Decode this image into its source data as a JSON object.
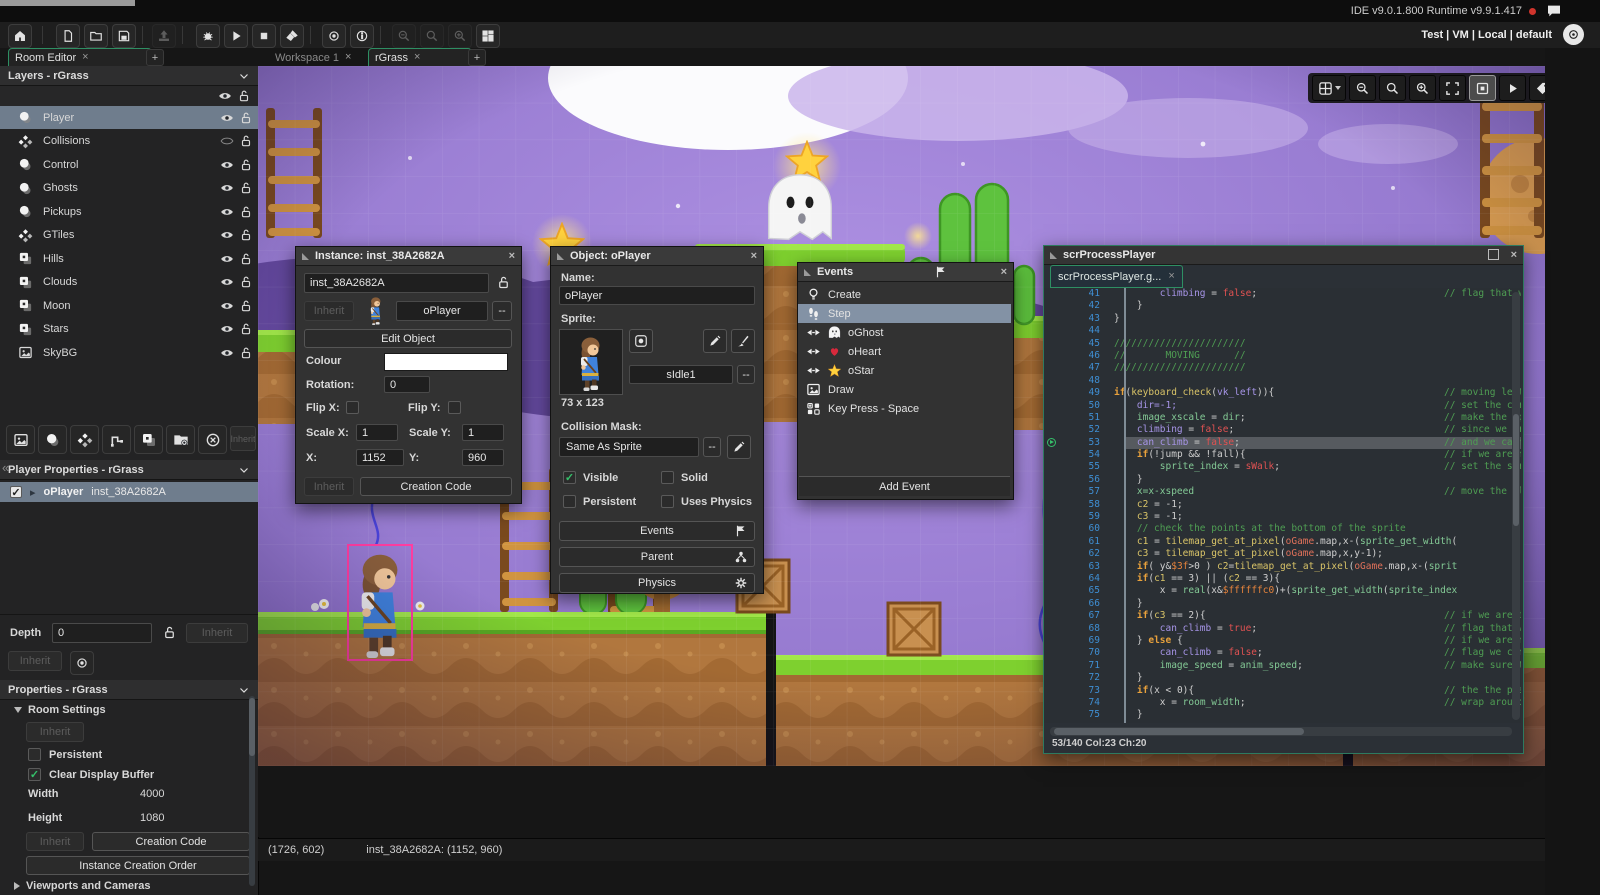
{
  "titlebar": {
    "version_text": "IDE v9.0.1.800 Runtime v9.9.1.417",
    "config_text": "Test | VM | Local | default"
  },
  "ui": {
    "more": "--",
    "inherit": "Inherit",
    "add": "+"
  },
  "tabs": {
    "left": [
      {
        "label": "Room Editor",
        "active": true
      }
    ],
    "right": [
      {
        "label": "Workspace 1",
        "active": false
      },
      {
        "label": "rGrass",
        "active": true
      }
    ]
  },
  "layers_panel": {
    "title": "Layers - rGrass",
    "items": [
      {
        "label": "Player",
        "icon": "instance",
        "visible": true,
        "selected": true
      },
      {
        "label": "Collisions",
        "icon": "tile",
        "visible": false,
        "selected": false
      },
      {
        "label": "Control",
        "icon": "instance",
        "visible": true,
        "selected": false
      },
      {
        "label": "Ghosts",
        "icon": "instance",
        "visible": true,
        "selected": false
      },
      {
        "label": "Pickups",
        "icon": "instance",
        "visible": true,
        "selected": false
      },
      {
        "label": "GTiles",
        "icon": "tile",
        "visible": true,
        "selected": false
      },
      {
        "label": "Hills",
        "icon": "asset",
        "visible": true,
        "selected": false
      },
      {
        "label": "Clouds",
        "icon": "asset",
        "visible": true,
        "selected": false
      },
      {
        "label": "Moon",
        "icon": "asset",
        "visible": true,
        "selected": false
      },
      {
        "label": "Stars",
        "icon": "asset",
        "visible": true,
        "selected": false
      },
      {
        "label": "SkyBG",
        "icon": "image",
        "visible": true,
        "selected": false
      }
    ]
  },
  "player_properties": {
    "title": "Player Properties - rGrass",
    "object_name": "oPlayer",
    "instance_id": "inst_38A2682A"
  },
  "depth_section": {
    "label": "Depth",
    "value": "0"
  },
  "properties_panel": {
    "title": "Properties - rGrass",
    "room_settings_title": "Room Settings",
    "persistent_label": "Persistent",
    "clear_display_buffer_label": "Clear Display Buffer",
    "width_label": "Width",
    "width_value": "4000",
    "height_label": "Height",
    "height_value": "1080",
    "creation_code_label": "Creation Code",
    "instance_creation_order_label": "Instance Creation Order",
    "viewports_label": "Viewports and Cameras"
  },
  "instance_window": {
    "title": "Instance: inst_38A2682A",
    "name_value": "inst_38A2682A",
    "object_combo": "oPlayer",
    "edit_object": "Edit Object",
    "colour_label": "Colour",
    "rotation_label": "Rotation:",
    "rotation_value": "0",
    "flip_x_label": "Flip X:",
    "flip_y_label": "Flip Y:",
    "scale_x_label": "Scale X:",
    "scale_x_value": "1",
    "scale_y_label": "Scale Y:",
    "scale_y_value": "1",
    "x_label": "X:",
    "x_value": "1152",
    "y_label": "Y:",
    "y_value": "960",
    "creation_code": "Creation Code"
  },
  "object_window": {
    "title": "Object: oPlayer",
    "name_label": "Name:",
    "name_value": "oPlayer",
    "sprite_label": "Sprite:",
    "sprite_name": "sIdle1",
    "sprite_size": "73 x 123",
    "collision_mask_label": "Collision Mask:",
    "collision_mask_value": "Same As Sprite",
    "visible_label": "Visible",
    "solid_label": "Solid",
    "persistent_label": "Persistent",
    "uses_physics_label": "Uses Physics",
    "events_label": "Events",
    "parent_label": "Parent",
    "physics_label": "Physics"
  },
  "events_window": {
    "title": "Events",
    "items": [
      {
        "label": "Create",
        "icon": "create",
        "selected": false
      },
      {
        "label": "Step",
        "icon": "step",
        "selected": true
      },
      {
        "label": "oGhost",
        "icon": "collision",
        "sprite": "ghost",
        "selected": false
      },
      {
        "label": "oHeart",
        "icon": "collision",
        "sprite": "heart",
        "selected": false
      },
      {
        "label": "oStar",
        "icon": "collision",
        "sprite": "star",
        "selected": false
      },
      {
        "label": "Draw",
        "icon": "draw",
        "selected": false
      },
      {
        "label": "Key Press - Space",
        "icon": "keypress",
        "selected": false
      }
    ],
    "add_event_label": "Add Event"
  },
  "code_window": {
    "title": "scrProcessPlayer",
    "tab": "scrProcessPlayer.g...",
    "status": "53/140 Col:23 Ch:20",
    "lines": [
      {
        "n": 41,
        "ind": 8,
        "seg": [
          [
            "climbing",
            "v"
          ],
          [
            " = ",
            "o"
          ],
          [
            "false",
            "r"
          ],
          [
            ";",
            "o"
          ]
        ],
        "cm": "// flag that we c"
      },
      {
        "n": 42,
        "ind": 4,
        "seg": [
          [
            "}",
            "o"
          ]
        ]
      },
      {
        "n": 43,
        "ind": 0,
        "seg": [
          [
            "}",
            "o"
          ]
        ]
      },
      {
        "n": 44,
        "ind": 0,
        "seg": []
      },
      {
        "n": 45,
        "ind": 0,
        "seg": [
          [
            "///////////////////////",
            "c"
          ]
        ]
      },
      {
        "n": 46,
        "ind": 0,
        "seg": [
          [
            "//       MOVING      //",
            "c"
          ]
        ]
      },
      {
        "n": 47,
        "ind": 0,
        "seg": [
          [
            "///////////////////////",
            "c"
          ]
        ]
      },
      {
        "n": 48,
        "ind": 0,
        "seg": []
      },
      {
        "n": 49,
        "ind": 0,
        "seg": [
          [
            "if",
            "k"
          ],
          [
            "(",
            "o"
          ],
          [
            "keyboard_check",
            "f"
          ],
          [
            "(",
            "o"
          ],
          [
            "vk_left",
            "v"
          ],
          [
            ")){",
            "o"
          ]
        ],
        "cm": "// moving left c"
      },
      {
        "n": 50,
        "ind": 4,
        "seg": [
          [
            "dir=-1;",
            "v"
          ]
        ],
        "cm": "// set the corre"
      },
      {
        "n": 51,
        "ind": 4,
        "seg": [
          [
            "image_xscale",
            "g"
          ],
          [
            " = ",
            "o"
          ],
          [
            "dir",
            "g"
          ],
          [
            ";",
            "o"
          ]
        ],
        "cm": "// make the spri"
      },
      {
        "n": 52,
        "ind": 4,
        "seg": [
          [
            "climbing",
            "v"
          ],
          [
            " = ",
            "o"
          ],
          [
            "false",
            "r"
          ],
          [
            ";",
            "o"
          ]
        ],
        "cm": "// since we are "
      },
      {
        "n": 53,
        "ind": 4,
        "seg": [
          [
            "can_climb",
            "v"
          ],
          [
            " = ",
            "o"
          ],
          [
            "false",
            "r"
          ],
          [
            ";",
            "o"
          ]
        ],
        "cm": "// and we cannot",
        "hl": true
      },
      {
        "n": 54,
        "ind": 4,
        "seg": [
          [
            "if",
            "k"
          ],
          [
            "(!jump && !fall){",
            "o"
          ]
        ],
        "cm": "// if we are not"
      },
      {
        "n": 55,
        "ind": 8,
        "seg": [
          [
            "sprite_index",
            "g"
          ],
          [
            " = ",
            "o"
          ],
          [
            "sWalk",
            "r"
          ],
          [
            ";",
            "o"
          ]
        ],
        "cm": "// set the sprit"
      },
      {
        "n": 56,
        "ind": 4,
        "seg": [
          [
            "}",
            "o"
          ]
        ]
      },
      {
        "n": 57,
        "ind": 4,
        "seg": [
          [
            "x=x-xspeed",
            "g"
          ]
        ],
        "cm": "// move the play"
      },
      {
        "n": 58,
        "ind": 4,
        "seg": [
          [
            "c2",
            "f"
          ],
          [
            " = -1;",
            "o"
          ]
        ]
      },
      {
        "n": 59,
        "ind": 4,
        "seg": [
          [
            "c3",
            "f"
          ],
          [
            " = -1;",
            "o"
          ]
        ]
      },
      {
        "n": 60,
        "ind": 4,
        "seg": [
          [
            "// check the points at the bottom of the sprite",
            "c"
          ]
        ]
      },
      {
        "n": 61,
        "ind": 4,
        "seg": [
          [
            "c1",
            "f"
          ],
          [
            " = ",
            "o"
          ],
          [
            "tilemap_get_at_pixel",
            "f"
          ],
          [
            "(",
            "o"
          ],
          [
            "oGame",
            "e"
          ],
          [
            ".map,x-(",
            "o"
          ],
          [
            "sprite_get_width",
            "g"
          ],
          [
            "(",
            "o"
          ]
        ]
      },
      {
        "n": 62,
        "ind": 4,
        "seg": [
          [
            "c3",
            "f"
          ],
          [
            " = ",
            "o"
          ],
          [
            "tilemap_get_at_pixel",
            "f"
          ],
          [
            "(",
            "o"
          ],
          [
            "oGame",
            "e"
          ],
          [
            ".map,x,y-1);",
            "o"
          ]
        ]
      },
      {
        "n": 63,
        "ind": 4,
        "seg": [
          [
            "if",
            "k"
          ],
          [
            "( y&",
            "o"
          ],
          [
            "$3f",
            "h"
          ],
          [
            ">0 ) ",
            "o"
          ],
          [
            "c2",
            "f"
          ],
          [
            "=",
            "o"
          ],
          [
            "tilemap_get_at_pixel",
            "f"
          ],
          [
            "(",
            "o"
          ],
          [
            "oGame",
            "e"
          ],
          [
            ".map,x-(",
            "o"
          ],
          [
            "sprit",
            "g"
          ]
        ]
      },
      {
        "n": 64,
        "ind": 4,
        "seg": [
          [
            "if",
            "k"
          ],
          [
            "(",
            "o"
          ],
          [
            "c1",
            "f"
          ],
          [
            " == 3) || (",
            "o"
          ],
          [
            "c2",
            "f"
          ],
          [
            " == 3){",
            "o"
          ]
        ]
      },
      {
        "n": 65,
        "ind": 8,
        "seg": [
          [
            "x = ",
            "o"
          ],
          [
            "real",
            "g"
          ],
          [
            "(x&",
            "o"
          ],
          [
            "$ffffffc0",
            "h"
          ],
          [
            ")+(",
            "o"
          ],
          [
            "sprite_get_width",
            "g"
          ],
          [
            "(",
            "o"
          ],
          [
            "sprite_index",
            "g"
          ]
        ]
      },
      {
        "n": 66,
        "ind": 4,
        "seg": [
          [
            "}",
            "o"
          ]
        ]
      },
      {
        "n": 67,
        "ind": 4,
        "seg": [
          [
            "if",
            "k"
          ],
          [
            "(",
            "o"
          ],
          [
            "c3",
            "f"
          ],
          [
            " == 2){",
            "o"
          ]
        ],
        "cm": "// if we are int"
      },
      {
        "n": 68,
        "ind": 8,
        "seg": [
          [
            "can_climb",
            "v"
          ],
          [
            " = ",
            "o"
          ],
          [
            "true",
            "r"
          ],
          [
            ";",
            "o"
          ]
        ],
        "cm": "// flag that we "
      },
      {
        "n": 69,
        "ind": 4,
        "seg": [
          [
            "} ",
            "o"
          ],
          [
            "else",
            "k"
          ],
          [
            " {",
            "o"
          ]
        ],
        "cm": "// if we are not"
      },
      {
        "n": 70,
        "ind": 8,
        "seg": [
          [
            "can_climb",
            "v"
          ],
          [
            " = ",
            "o"
          ],
          [
            "false",
            "r"
          ],
          [
            ";",
            "o"
          ]
        ],
        "cm": "// flag we cant "
      },
      {
        "n": 71,
        "ind": 8,
        "seg": [
          [
            "image_speed",
            "g"
          ],
          [
            " = ",
            "o"
          ],
          [
            "anim_speed",
            "g"
          ],
          [
            ";",
            "o"
          ]
        ],
        "cm": "// make sure the"
      },
      {
        "n": 72,
        "ind": 4,
        "seg": [
          [
            "}",
            "o"
          ]
        ]
      },
      {
        "n": 73,
        "ind": 4,
        "seg": [
          [
            "if",
            "k"
          ],
          [
            "(x < 0){",
            "o"
          ]
        ],
        "cm": "// the the playe"
      },
      {
        "n": 74,
        "ind": 8,
        "seg": [
          [
            "x = ",
            "o"
          ],
          [
            "room_width",
            "g"
          ],
          [
            ";",
            "o"
          ]
        ],
        "cm": "// wrap around t"
      },
      {
        "n": 75,
        "ind": 4,
        "seg": [
          [
            "}",
            "o"
          ]
        ]
      }
    ]
  },
  "statusbar": {
    "cursor": "(1726, 602)",
    "instance": "inst_38A2682A: (1152, 960)"
  }
}
